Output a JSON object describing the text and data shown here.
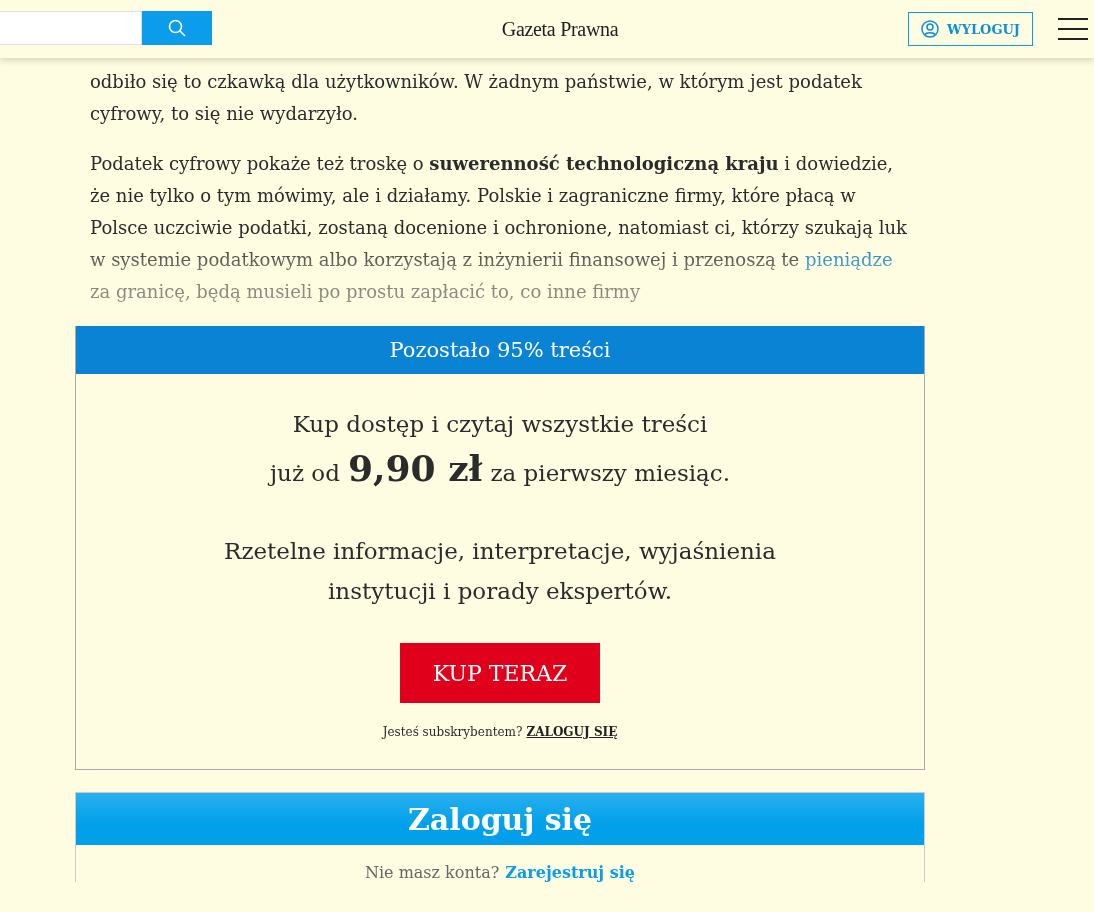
{
  "header": {
    "logo": "Gazeta Prawna",
    "logout_button": "WYLOGUJ"
  },
  "article": {
    "paragraphs": [
      {
        "segments": [
          {
            "text": "odbiło się to czkawką dla użytkowników. W żadnym państwie, w którym jest podatek cyfrowy, to się nie wydarzyło."
          }
        ],
        "faded": false
      },
      {
        "segments": [
          {
            "text": "Podatek cyfrowy pokaże też troskę o **suwerenność technologiczną kraju** i dowiedzie, że nie tylko o tym mówimy, ale i działamy. Polskie i zagraniczne firmy, które płacą w Polsce uczciwie podatki, zostaną docenione i ochronione, natomiast ci, którzy szukają luk w systemie podatkowym albo korzystają z inżynierii finansowej i przenoszą te "
          },
          {
            "text": "pieniądze",
            "link": true
          },
          {
            "text": " za granicę, będą musieli po prostu zapłacić to, co inne firmy"
          }
        ],
        "faded": true
      }
    ]
  },
  "paywall": {
    "banner": "Pozostało 95% treści",
    "line1": "Kup dostęp i czytaj wszystkie treści",
    "price_prefix": "już od",
    "price": "9,90 zł",
    "price_suffix": "za pierwszy miesiąc.",
    "benefits_1": "Rzetelne informacje, interpretacje, wyjaśnienia",
    "benefits_2": "instytucji i porady ekspertów.",
    "buy_button": "KUP TERAZ",
    "subscriber_prompt": "Jesteś subskrybentem?",
    "login_link": "ZALOGUJ SIĘ"
  },
  "login": {
    "title": "Zaloguj się",
    "prompt": "Nie masz konta?",
    "register_link": "Zarejestruj się"
  }
}
